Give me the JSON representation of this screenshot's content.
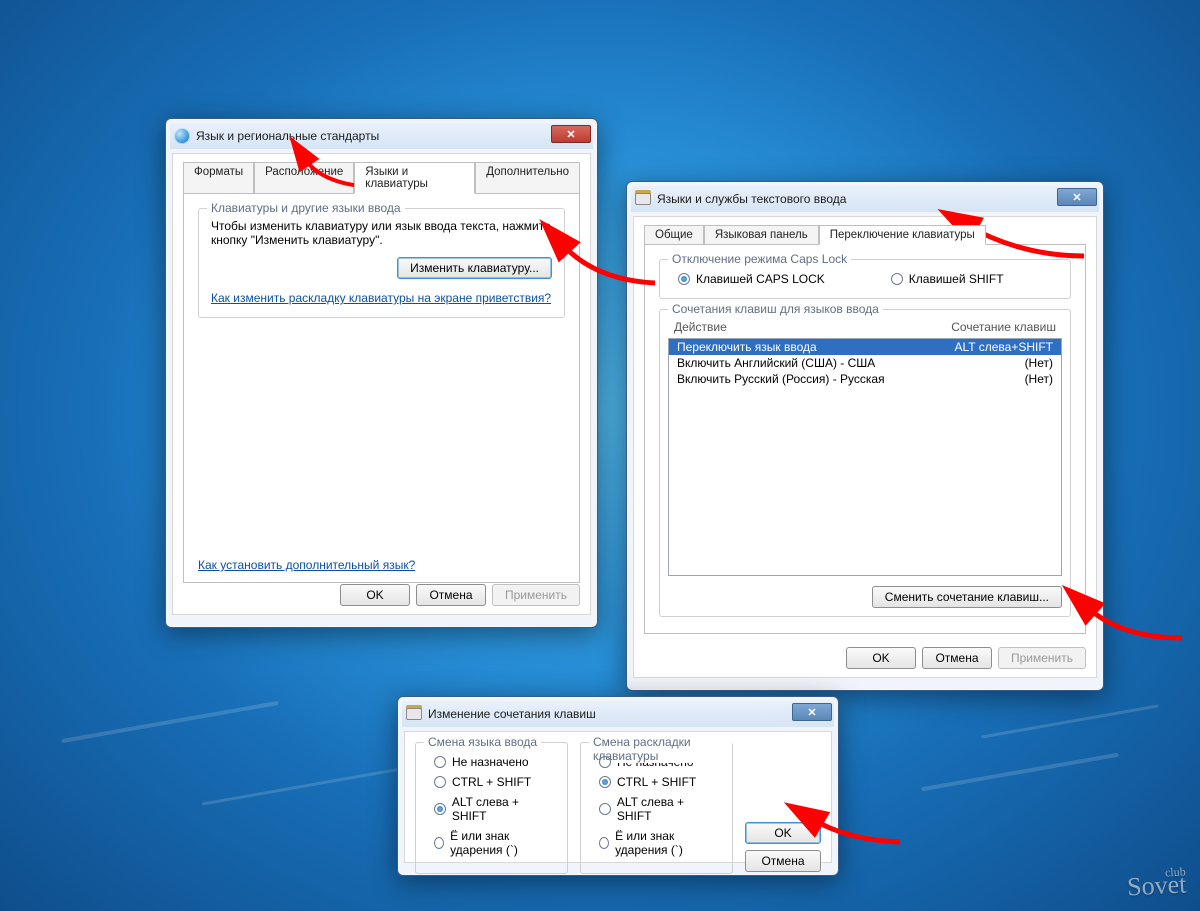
{
  "watermark": {
    "club": "club",
    "name": "Sovet"
  },
  "win1": {
    "title": "Язык и региональные стандарты",
    "tabs": [
      "Форматы",
      "Расположение",
      "Языки и клавиатуры",
      "Дополнительно"
    ],
    "active_tab": 2,
    "group_title": "Клавиатуры и другие языки ввода",
    "group_text": "Чтобы изменить клавиатуру или язык ввода текста, нажмите кнопку \"Изменить клавиатуру\".",
    "change_kbd_btn": "Изменить клавиатуру...",
    "link1": "Как изменить раскладку клавиатуры на экране приветствия?",
    "link2": "Как установить дополнительный язык?",
    "ok": "OK",
    "cancel": "Отмена",
    "apply": "Применить"
  },
  "win2": {
    "title": "Языки и службы текстового ввода",
    "tabs": [
      "Общие",
      "Языковая панель",
      "Переключение клавиатуры"
    ],
    "active_tab": 2,
    "capslock_group": "Отключение режима Caps Lock",
    "caps_opt1": "Клавишей CAPS LOCK",
    "caps_opt2": "Клавишей SHIFT",
    "hotkeys_group": "Сочетания клавиш для языков ввода",
    "col_action": "Действие",
    "col_combo": "Сочетание клавиш",
    "rows": [
      {
        "action": "Переключить язык ввода",
        "combo": "ALT слева+SHIFT",
        "selected": true
      },
      {
        "action": "Включить Английский (США) - США",
        "combo": "(Нет)",
        "selected": false
      },
      {
        "action": "Включить Русский (Россия) - Русская",
        "combo": "(Нет)",
        "selected": false
      }
    ],
    "change_combo_btn": "Сменить сочетание клавиш...",
    "ok": "OK",
    "cancel": "Отмена",
    "apply": "Применить"
  },
  "win3": {
    "title": "Изменение сочетания клавиш",
    "left_group": "Смена языка ввода",
    "right_group": "Смена раскладки клавиатуры",
    "opts": [
      "Не назначено",
      "CTRL + SHIFT",
      "ALT слева + SHIFT",
      "Ё или знак ударения (`)"
    ],
    "left_selected": 2,
    "right_selected": 1,
    "ok": "OK",
    "cancel": "Отмена"
  }
}
